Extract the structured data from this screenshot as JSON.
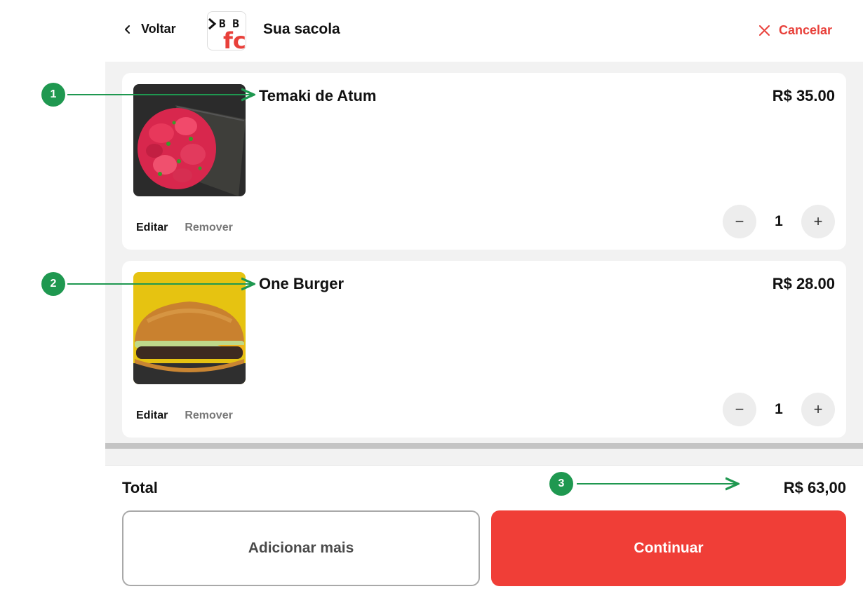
{
  "header": {
    "back_label": "Voltar",
    "title": "Sua sacola",
    "cancel_label": "Cancelar",
    "logo_text_top": "B B",
    "logo_text_bottom": "fc"
  },
  "items": [
    {
      "name": "Temaki de Atum",
      "price": "R$ 35.00",
      "edit_label": "Editar",
      "remove_label": "Remover",
      "quantity": "1",
      "minus": "−",
      "plus": "+"
    },
    {
      "name": "One Burger",
      "price": "R$ 28.00",
      "edit_label": "Editar",
      "remove_label": "Remover",
      "quantity": "1",
      "minus": "−",
      "plus": "+"
    }
  ],
  "footer": {
    "total_label": "Total",
    "total_value": "R$ 63,00",
    "add_more_label": "Adicionar mais",
    "continue_label": "Continuar"
  },
  "annotations": [
    "1",
    "2",
    "3"
  ],
  "colors": {
    "accent": "#f03e37",
    "annotation": "#1f9850"
  }
}
